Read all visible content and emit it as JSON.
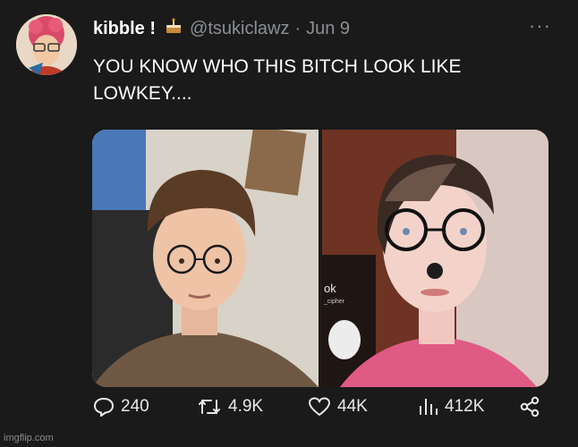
{
  "tweet": {
    "display_name": "kibble !",
    "emoji": "cake-emoji",
    "handle": "@tsukiclawz",
    "separator": "·",
    "date": "Jun 9",
    "text": "YOU KNOW WHO THIS BITCH LOOK LIKE LOWKEY....",
    "more_label": "···"
  },
  "media": {
    "left_photo": "photo-person-glasses-curly-hair",
    "right_photo": "photo-person-glasses-nose-ring",
    "overlay_text": "ok",
    "overlay_subtext": "_cipher"
  },
  "actions": {
    "replies": "240",
    "reposts": "4.9K",
    "likes": "44K",
    "views": "412K"
  },
  "icons": {
    "reply": "reply-icon",
    "repost": "repost-icon",
    "like": "heart-icon",
    "views": "views-icon",
    "share": "share-icon"
  },
  "watermark": "imgflip.com"
}
